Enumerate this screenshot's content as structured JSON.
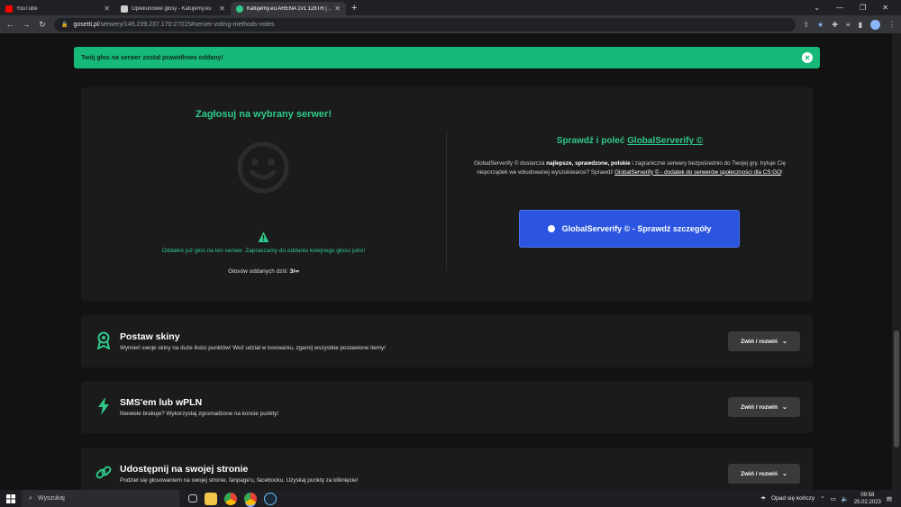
{
  "browser": {
    "tabs": [
      {
        "title": "YouTube",
        "favicon_color": "#ff0000",
        "active": false
      },
      {
        "title": "Opiekunowie głosy - Katujemy.eu",
        "favicon_color": "#cccccc",
        "active": false
      },
      {
        "title": "Katujemy.eu ARENA 1v1 128TR | ...",
        "favicon_color": "#2ec98a",
        "active": true
      }
    ],
    "url_host": "gosetti.pl",
    "url_path": "/serwery/145.239.237.170:27015#server-voting-methods-votes"
  },
  "toast": {
    "message": "Twój głos na serwer został prawidłowo oddany!",
    "close": "✕"
  },
  "vote": {
    "title": "Zagłosuj na wybrany serwer!",
    "already_voted": "Oddałeś już głos na ten serwer. Zapraszamy do oddania kolejnego głosu jutro!",
    "votes_label": "Głosów oddanych dziś:",
    "votes_value": "3/∞"
  },
  "globalserverify": {
    "title_prefix": "Sprawdź i poleć",
    "title_link": "GlobalServerify ©",
    "desc_part1": "GlobalServerify © dostarcza",
    "desc_bold": "najlepsze, sprawdzone, polskie",
    "desc_part2": "i zagraniczne serwery bezpośrednio do Twojej gry. Irytuje Cię nieporządek we wbudowanej wyszukiwarce? Sprawdź",
    "desc_link": "GlobalServerify © - dodatek do serwerów społeczności dla CS:GO",
    "desc_end": "!",
    "button_label": "GlobalServerify © - Sprawdź szczegóły"
  },
  "cards": [
    {
      "title": "Postaw skiny",
      "subtitle": "Wymień swoje skiny na duże ilości punktów! Weź udział w losowaniu, zgarnij wszystkie postawione itemy!",
      "icon": "award-icon",
      "toggle": "Zwiń / rozwiń"
    },
    {
      "title": "SMS'em lub wPLN",
      "subtitle": "Niewiele brakuje? Wykorzystaj zgromadzone na koncie punkty!",
      "icon": "lightning-icon",
      "toggle": "Zwiń / rozwiń"
    },
    {
      "title": "Udostępnij na swojej stronie",
      "subtitle": "Podziel się głosowaniem na swojej stronie, fanpage'u, facebooku. Uzyskaj punkty za kliknięcie!",
      "icon": "link-icon",
      "toggle": "Zwiń / rozwiń"
    }
  ],
  "taskbar": {
    "search_placeholder": "Wyszukaj",
    "weather": "Opad się kończy",
    "time": "09:58",
    "date": "25.02.2023"
  },
  "colors": {
    "accent": "#2ec98a",
    "toast": "#17b978",
    "button": "#2b55e0"
  }
}
